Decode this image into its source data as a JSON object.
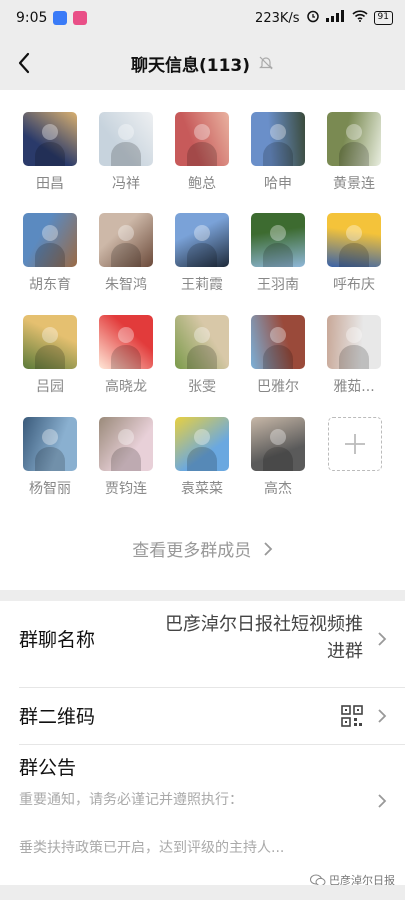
{
  "status_bar": {
    "time": "9:05",
    "speed": "223K/s",
    "battery": "91",
    "badge_colors": [
      "#3a7bf7",
      "#e94f87"
    ]
  },
  "header": {
    "title": "聊天信息(113)"
  },
  "members": [
    {
      "name": "田昌",
      "colors": [
        "#2a3a6a",
        "#d9b070"
      ]
    },
    {
      "name": "冯祥",
      "colors": [
        "#c7d3dd",
        "#eef0f2"
      ]
    },
    {
      "name": "鲍总",
      "colors": [
        "#c75a5a",
        "#e9b2a0"
      ]
    },
    {
      "name": "哈申",
      "colors": [
        "#6a8fc9",
        "#3a4a3a"
      ]
    },
    {
      "name": "黄景连",
      "colors": [
        "#7a8a52",
        "#e9eee0"
      ]
    },
    {
      "name": "胡东育",
      "colors": [
        "#5b8ac0",
        "#9a6a45"
      ]
    },
    {
      "name": "朱智鸿",
      "colors": [
        "#cdb8a8",
        "#6b4a3a"
      ]
    },
    {
      "name": "王莉霞",
      "colors": [
        "#7aa2d8",
        "#1e2a3a"
      ]
    },
    {
      "name": "王羽南",
      "colors": [
        "#3d6b30",
        "#8fb7d8"
      ]
    },
    {
      "name": "呼布庆",
      "colors": [
        "#f4c33a",
        "#3a62a8"
      ]
    },
    {
      "name": "吕园",
      "colors": [
        "#e5c070",
        "#5b7a3a"
      ]
    },
    {
      "name": "高晓龙",
      "colors": [
        "#e23b3b",
        "#ffe8d8"
      ]
    },
    {
      "name": "张雯",
      "colors": [
        "#d8c8a8",
        "#7a9a4a"
      ]
    },
    {
      "name": "巴雅尔",
      "colors": [
        "#9a4a3a",
        "#7ab0d8"
      ]
    },
    {
      "name": "雅茹...",
      "colors": [
        "#e8e8e8",
        "#c8a898"
      ]
    },
    {
      "name": "杨智丽",
      "colors": [
        "#8ab0d0",
        "#3a5a7a"
      ]
    },
    {
      "name": "贾钧连",
      "colors": [
        "#e8d0d8",
        "#9a8a7a"
      ]
    },
    {
      "name": "袁菜菜",
      "colors": [
        "#6aa8e0",
        "#e8d040"
      ]
    },
    {
      "name": "高杰",
      "colors": [
        "#5a5a5a",
        "#c8b8a8"
      ]
    }
  ],
  "more_members_label": "查看更多群成员",
  "settings": {
    "group_name_label": "群聊名称",
    "group_name_value_line1": "巴彦淖尔日报社短视频推",
    "group_name_value_line2": "进群",
    "qr_label": "群二维码",
    "notice_label": "群公告",
    "notice_line1": "重要通知，请务必谨记并遵照执行：",
    "notice_line2": "垂类扶持政策已开启，达到评级的主持人..."
  },
  "watermark": "巴彦淖尔日报"
}
